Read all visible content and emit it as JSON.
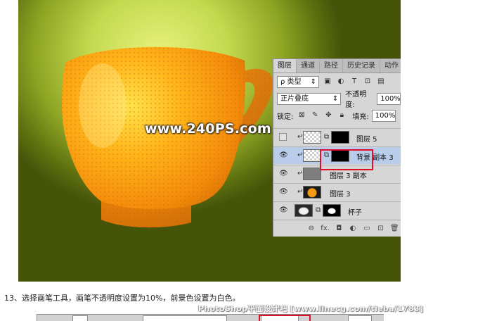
{
  "artwork": {
    "watermark": "www.240PS.com"
  },
  "layers_panel": {
    "tabs": [
      {
        "label": "图层",
        "active": true
      },
      {
        "label": "通道",
        "active": false
      },
      {
        "label": "路径",
        "active": false
      },
      {
        "label": "历史记录",
        "active": false
      },
      {
        "label": "动作",
        "active": false
      }
    ],
    "filter": {
      "prefix": "ρ",
      "label": "类型"
    },
    "filter_icons": [
      "image-filter-icon",
      "adjustment-filter-icon",
      "type-filter-icon",
      "shape-filter-icon",
      "smart-object-filter-icon"
    ],
    "blend_mode": "正片叠底",
    "opacity_label": "不透明度:",
    "opacity_value": "100%",
    "lock_label": "锁定:",
    "fill_label": "填充:",
    "fill_value": "100%",
    "layers": [
      {
        "name": "图层 5",
        "visible": false,
        "clipped": true,
        "thumb": "checker",
        "mask": "black",
        "selected": false
      },
      {
        "name": "背景 副本 3",
        "visible": true,
        "clipped": true,
        "thumb": "checker",
        "mask": "black",
        "selected": true
      },
      {
        "name": "图层 3 副本",
        "visible": true,
        "clipped": true,
        "thumb": "gray",
        "mask": null,
        "selected": false
      },
      {
        "name": "图层 3",
        "visible": true,
        "clipped": true,
        "thumb": "orange",
        "mask": null,
        "selected": false
      },
      {
        "name": "杯子",
        "visible": true,
        "clipped": false,
        "thumb": "cup",
        "mask": "cup-white",
        "selected": false
      }
    ],
    "bottom_buttons": [
      {
        "name": "link-layers",
        "glyph": "⊖"
      },
      {
        "name": "add-layer-style",
        "glyph": "fx."
      },
      {
        "name": "add-mask",
        "glyph": "◘"
      },
      {
        "name": "new-adjustment-layer",
        "glyph": "◐"
      },
      {
        "name": "new-group",
        "glyph": "▭"
      },
      {
        "name": "new-layer",
        "glyph": "⊡"
      },
      {
        "name": "delete-layer",
        "glyph": "🗑"
      }
    ]
  },
  "caption": {
    "text": "13、选择画笔工具，画笔不透明度设置为10%，前景色设置为白色。"
  },
  "site_watermark": "PhotoShop平面设计吧 [www.linecg.com/tieba/1783]"
}
